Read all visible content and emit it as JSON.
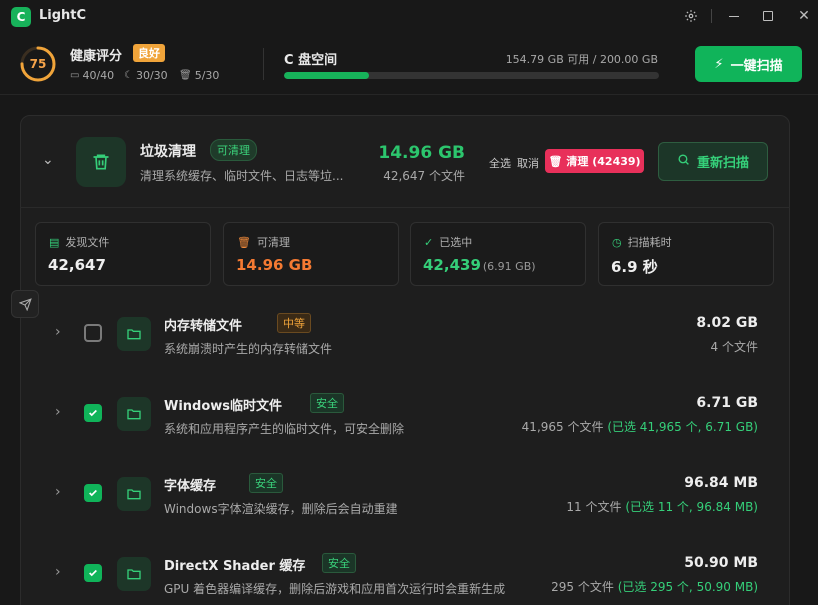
{
  "app": {
    "title": "LightC",
    "logo_glyph": "C"
  },
  "health": {
    "score": "75",
    "score_fraction": 0.75,
    "label": "健康评分",
    "badge": "良好",
    "stats": [
      "40/40",
      "30/30",
      "5/30"
    ]
  },
  "disk": {
    "label": "C 盘空间",
    "info": "154.79 GB 可用 / 200.00 GB",
    "used_fraction": 0.226
  },
  "top_scan_button": "一键扫描",
  "junk": {
    "title": "垃圾清理",
    "badge": "可清理",
    "desc": "清理系统缓存、临时文件、日志等垃...",
    "size": "14.96 GB",
    "count": "42,647 个文件",
    "select_all": "全选",
    "cancel": "取消",
    "clean_button": "清理 (42439)",
    "rescan_button": "重新扫描"
  },
  "stats": [
    {
      "label": "发现文件",
      "value": "42,647",
      "sub": ""
    },
    {
      "label": "可清理",
      "value": "14.96 GB",
      "sub": ""
    },
    {
      "label": "已选中",
      "value": "42,439",
      "sub": "(6.91 GB)"
    },
    {
      "label": "扫描耗时",
      "value": "6.9 秒",
      "sub": ""
    }
  ],
  "rows": [
    {
      "name": "内存转储文件",
      "tag": "中等",
      "desc": "系统崩溃时产生的内存转储文件",
      "size": "8.02 GB",
      "files": "4 个文件",
      "selected": "",
      "checked": false
    },
    {
      "name": "Windows临时文件",
      "tag": "安全",
      "desc": "系统和应用程序产生的临时文件，可安全删除",
      "size": "6.71 GB",
      "files": "41,965 个文件",
      "selected": "(已选 41,965 个, 6.71 GB)",
      "checked": true
    },
    {
      "name": "字体缓存",
      "tag": "安全",
      "desc": "Windows字体渲染缓存，删除后会自动重建",
      "size": "96.84 MB",
      "files": "11 个文件",
      "selected": "(已选 11 个, 96.84 MB)",
      "checked": true
    },
    {
      "name": "DirectX Shader 缓存",
      "tag": "安全",
      "desc": "GPU 着色器编译缓存，删除后游戏和应用首次运行时会重新生成",
      "size": "50.90 MB",
      "files": "295 个文件",
      "selected": "(已选 295 个, 50.90 MB)",
      "checked": true
    }
  ],
  "colors": {
    "accent": "#10b45a",
    "warning": "#f0a43a",
    "danger": "#e8305a"
  }
}
